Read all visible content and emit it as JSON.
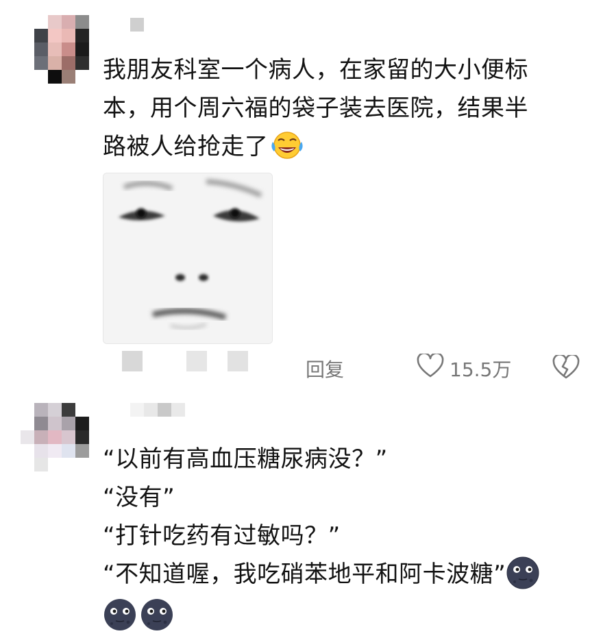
{
  "comments": [
    {
      "text_lines": [
        "我朋友科室一个病人，在家留的大小便标",
        "本，用个周六福的袋子装去医院，结果半",
        "路被人给抢走了"
      ],
      "emoji": "face-with-tears-of-joy-icon",
      "has_image": true,
      "reply_label": "回复",
      "like_count": "15.5万"
    },
    {
      "text_lines": [
        "“以前有高血压糖尿病没？”",
        "“没有”",
        "“打针吃药有过敏吗？”",
        "“不知道喔，我吃硝苯地平和阿卡波糖”"
      ],
      "emoji": "new-moon-face-icon"
    }
  ],
  "colors": {
    "text": "#121212",
    "meta": "#777777",
    "moon": "#3b4056"
  }
}
